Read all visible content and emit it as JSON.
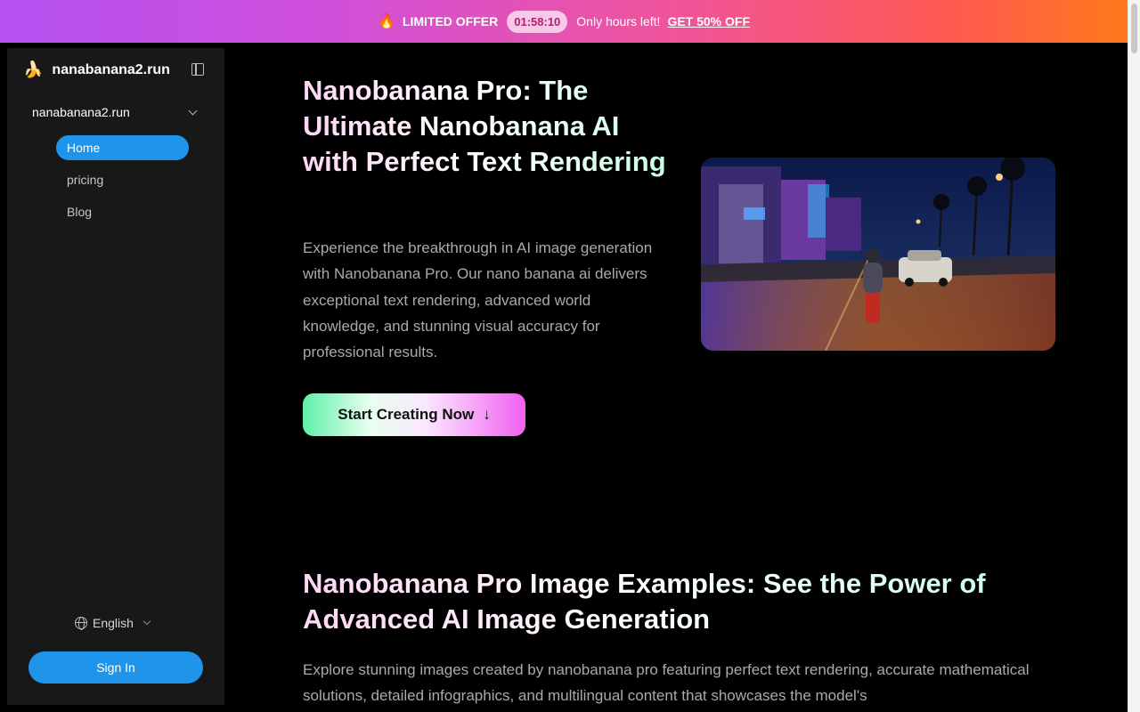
{
  "promo": {
    "icon": "fire-icon",
    "label": "LIMITED OFFER",
    "timer": "01:58:10",
    "hours_text": "Only hours left!",
    "cta": "GET 50% OFF"
  },
  "sidebar": {
    "brand": "nanabanana2.run",
    "group_label": "nanabanana2.run",
    "items": [
      {
        "label": "Home",
        "active": true
      },
      {
        "label": "pricing",
        "active": false
      },
      {
        "label": "Blog",
        "active": false
      }
    ],
    "language": "English",
    "signin_label": "Sign In"
  },
  "hero": {
    "title": "Nanobanana Pro: The Ultimate Nanobanana AI with Perfect Text Rendering",
    "description": "Experience the breakthrough in AI image generation with Nanobanana Pro. Our nano banana ai delivers exceptional text rendering, advanced world knowledge, and stunning visual accuracy for professional results.",
    "cta_label": "Start Creating Now",
    "cta_icon": "↓"
  },
  "examples": {
    "title": "Nanobanana Pro Image Examples: See the Power of Advanced AI Image Generation",
    "description": "Explore stunning images created by nanobanana pro featuring perfect text rendering, accurate mathematical solutions, detailed infographics, and multilingual content that showcases the model's"
  },
  "colors": {
    "accent": "#1e94ea",
    "sidebar_bg": "#181818",
    "background": "#000000"
  }
}
